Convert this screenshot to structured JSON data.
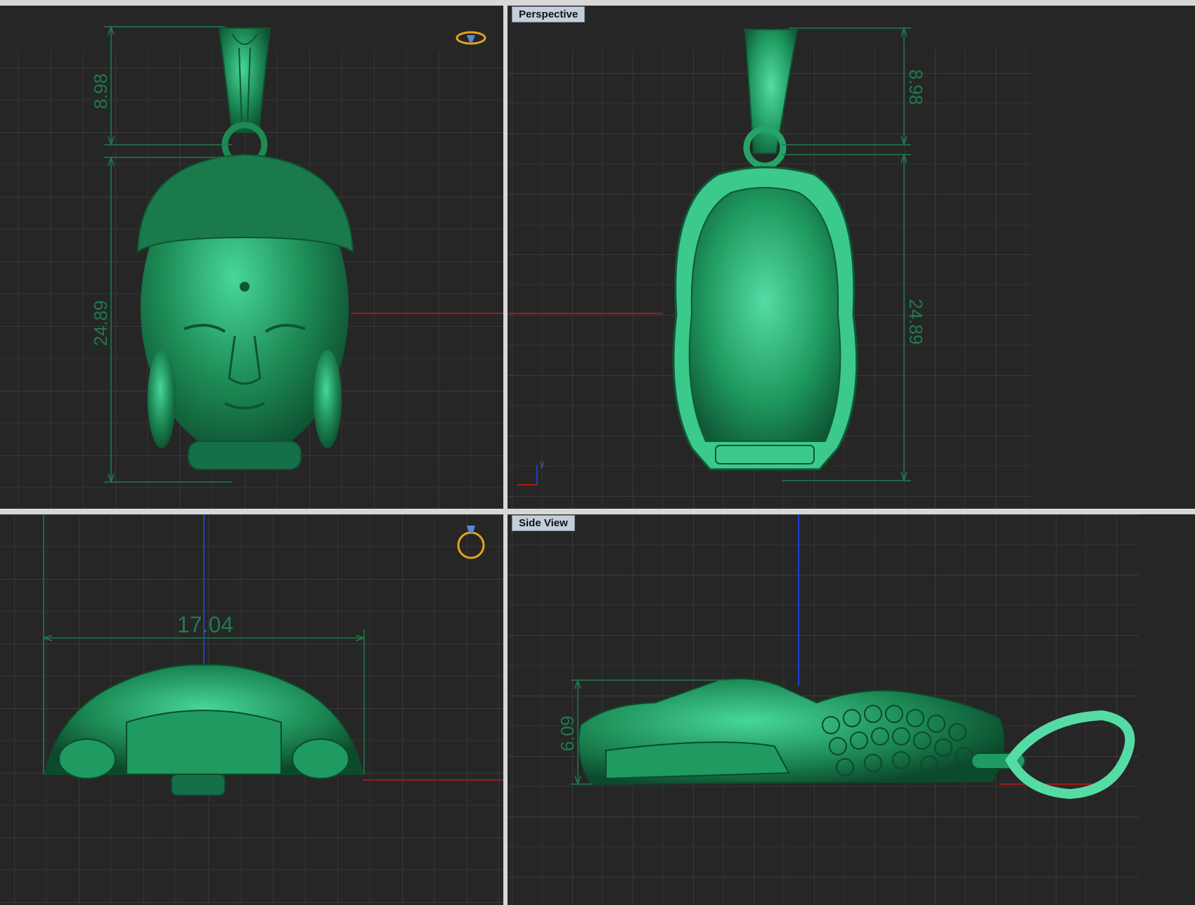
{
  "viewports": {
    "front": {
      "label": "",
      "dims": {
        "bail_height": "8.98",
        "head_height": "24.89"
      },
      "icon": "ring-icon"
    },
    "perspective": {
      "label": "Perspective",
      "dims": {
        "bail_height": "8.98",
        "head_height": "24.89"
      },
      "axis_y": "y"
    },
    "top": {
      "label": "",
      "dims": {
        "width": "17.04"
      },
      "icon": "ring-icon"
    },
    "side": {
      "label": "Side View",
      "dims": {
        "depth": "6.09"
      }
    }
  },
  "colors": {
    "viewport_bg": "#262626",
    "grid_minor": "#3a3a3a",
    "grid_major": "#4a4a4a",
    "model_green": "#1d8a55",
    "model_light": "#3fcf91",
    "dimension_line": "#1f7a4c",
    "axis_x": "#b01818",
    "axis_y": "#1c3fd0",
    "label_bg": "#c4cedb",
    "ring_icon": "#e6a21d"
  }
}
